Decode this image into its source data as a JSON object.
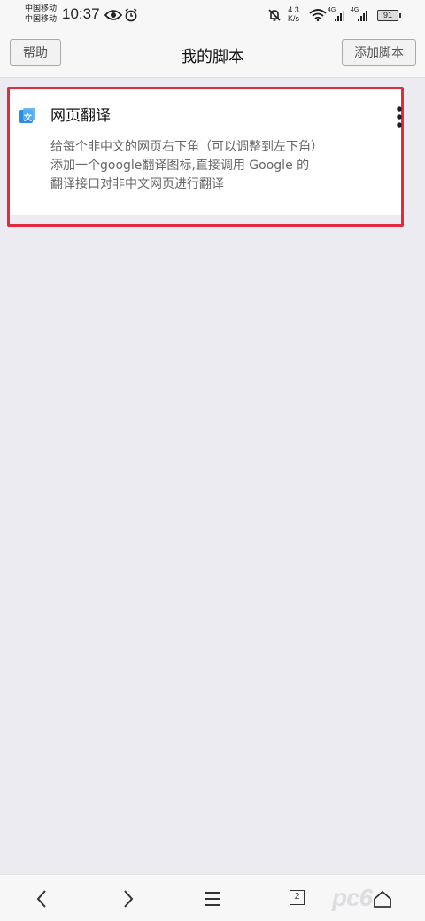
{
  "status_bar": {
    "carrier_1": "中国移动",
    "carrier_2": "中国移动",
    "time": "10:37",
    "net_speed_value": "4.3",
    "net_speed_unit": "K/s",
    "signal_1_label": "4G",
    "signal_2_label": "4G",
    "battery": "91"
  },
  "header": {
    "help_label": "帮助",
    "title": "我的脚本",
    "add_label": "添加脚本"
  },
  "scripts": [
    {
      "name": "网页翻译",
      "description_lines": [
        "给每个非中文的网页右下角（可以调整到左下角）",
        "添加一个google翻译图标,直接调用 Google 的",
        "翻译接口对非中文网页进行翻译"
      ]
    }
  ],
  "bottom_nav": {
    "tab_count": "2"
  },
  "watermark": "pc6",
  "colors": {
    "highlight_border": "#e02c3d",
    "icon_blue": "#2b8de6",
    "background": "#ecebf1"
  }
}
